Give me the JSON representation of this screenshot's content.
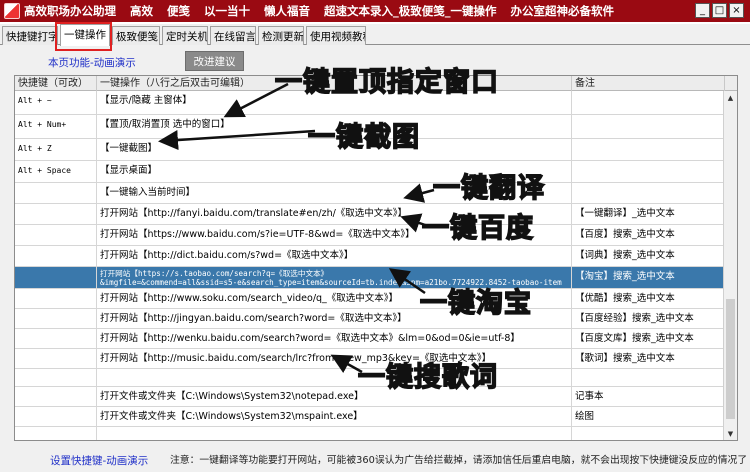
{
  "titlebar": {
    "app_title": "高效职场办公助理",
    "menu": [
      "高效",
      "便笺",
      "以一当十",
      "懒人福音",
      "超速文本录入_极致便笺_一键操作",
      "办公室超神必备软件"
    ],
    "min_glyph": "_",
    "max_glyph": "□",
    "close_glyph": "×"
  },
  "tabs": [
    "快捷键打字",
    "一键操作",
    "极致便笺",
    "定时关机",
    "在线留言",
    "检测更新",
    "使用视频教程"
  ],
  "active_tab": 1,
  "panel": {
    "demo_link": "本页功能-动画演示",
    "improve_button": "改进建议",
    "settings_link": "设置快捷键-动画演示",
    "notice": "注意：一键翻译等功能要打开网站，可能被360误认为广告给拦截掉，请添加信任后重启电脑，就不会出现按下快捷键没反应的情况了"
  },
  "grid": {
    "headers": [
      "快捷键（可改）",
      "一键操作（八行之后双击可编辑）",
      "备注"
    ],
    "rows": [
      {
        "key": "Alt + ~",
        "action": "【显示/隐藏 主窗体】",
        "note": ""
      },
      {
        "key": "Alt + Num+",
        "action": "【置顶/取消置顶 选中的窗口】",
        "note": ""
      },
      {
        "key": "Alt + Z",
        "action": "【一键截图】",
        "note": ""
      },
      {
        "key": "Alt + Space",
        "action": "【显示桌面】",
        "note": ""
      },
      {
        "key": "",
        "action": "【一键输入当前时间】",
        "note": ""
      },
      {
        "key": "",
        "action": "打开网站【http://fanyi.baidu.com/translate#en/zh/《取选中文本》】",
        "note": "【一键翻译】_选中文本"
      },
      {
        "key": "",
        "action": "打开网站【https://www.baidu.com/s?ie=UTF-8&wd=《取选中文本》】",
        "note": "【百度】搜索_选中文本"
      },
      {
        "key": "",
        "action": "打开网站【http://dict.baidu.com/s?wd=《取选中文本》】",
        "note": "【词典】搜索_选中文本"
      },
      {
        "key": "",
        "action": "打开网站【https://s.taobao.com/search?q=《取选中文本》",
        "action2": "&imgfile=&commend=all&ssid=s5-e&search_type=item&sourceId=tb.index&spm=a21bo.7724922.8452-taobao-item",
        "note": "【淘宝】搜索_选中文本"
      },
      {
        "key": "",
        "action": "打开网站【http://www.soku.com/search_video/q_《取选中文本》】",
        "note": "【优酷】搜索_选中文本"
      },
      {
        "key": "",
        "action": "打开网站【http://jingyan.baidu.com/search?word=《取选中文本》】",
        "note": "【百度经验】搜索_选中文本"
      },
      {
        "key": "",
        "action": "打开网站【http://wenku.baidu.com/search?word=《取选中文本》&lm=0&od=0&ie=utf-8】",
        "note": "【百度文库】搜索_选中文本"
      },
      {
        "key": "",
        "action": "打开网站【http://music.baidu.com/search/lrc?from=new_mp3&key=《取选中文本》】",
        "note": "【歌词】搜索_选中文本"
      },
      {
        "key": "",
        "action": "",
        "note": ""
      },
      {
        "key": "",
        "action": "打开文件或文件夹【C:\\Windows\\System32\\notepad.exe】",
        "note": "记事本"
      },
      {
        "key": "",
        "action": "打开文件或文件夹【C:\\Windows\\System32\\mspaint.exe】",
        "note": "绘图"
      },
      {
        "key": "",
        "action": "",
        "note": ""
      }
    ],
    "selected_row": 8
  },
  "annotations": {
    "pin": "一键置顶指定窗口",
    "screenshot": "一键截图",
    "translate": "一键翻译",
    "baidu": "一键百度",
    "taobao": "一键淘宝",
    "lyrics": "一键搜歌词"
  },
  "colors": {
    "titlebar": "#9a0a12",
    "selection": "#3a78ab",
    "annotation_stroke": "#111111",
    "highlight_box": "#e02020"
  }
}
